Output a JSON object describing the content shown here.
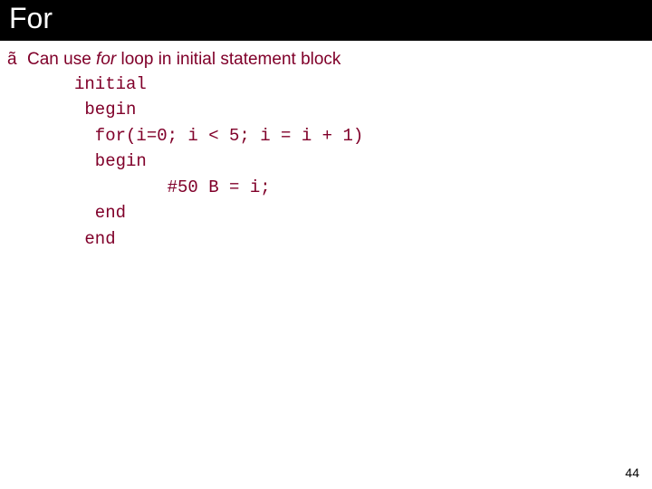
{
  "title": "For",
  "bullet": {
    "marker": "ã",
    "pre": "Can use ",
    "keyword": "for",
    "post": " loop in initial statement block"
  },
  "code": {
    "l1": "initial",
    "l2": " begin",
    "l3": "  for(i=0; i < 5; i = i + 1)",
    "l4": "  begin",
    "l5": "         #50 B = i;",
    "l6": "  end",
    "l7": " end"
  },
  "page_number": "44"
}
